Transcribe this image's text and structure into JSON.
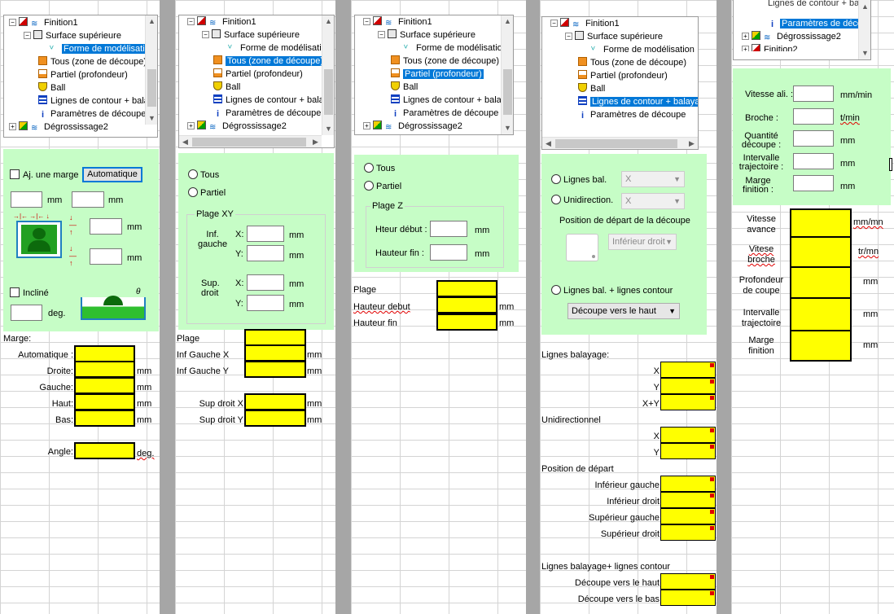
{
  "tree": {
    "finition1": "Finition1",
    "surface": "Surface supérieure",
    "forme": "Forme de modélisation",
    "tous": "Tous (zone de découpe)",
    "partiel": "Partiel (profondeur)",
    "ball": "Ball",
    "lignes": "Lignes de contour + balayage",
    "lignes_short": "Lignes de contour + balay·",
    "params": "Paramètres de découpe",
    "degro": "Dégrossissage2",
    "finition2": "Finition2",
    "lignes_top": "Lignes de contour + balay·"
  },
  "p1": {
    "chk_marge": "Aj. une marge",
    "btn_auto": "Automatique",
    "unit_mm": "mm",
    "chk_incline": "Incliné",
    "unit_deg": "deg.",
    "sheet": {
      "marge": "Marge:",
      "auto": "Automatique :",
      "droite": "Droite:",
      "gauche": "Gauche:",
      "haut": "Haut:",
      "bas": "Bas:",
      "angle": "Angle:",
      "mm": "mm",
      "deg": "deg."
    }
  },
  "p2": {
    "tous": "Tous",
    "partiel": "Partiel",
    "plage_xy": "Plage XY",
    "inf_gauche": "Inf.\ngauche",
    "sup_droit": "Sup.\ndroit",
    "x": "X:",
    "y": "Y:",
    "mm": "mm",
    "sheet": {
      "plage": "Plage",
      "infx": "Inf Gauche X",
      "infy": "Inf Gauche Y",
      "supx": "Sup droit X",
      "supy": "Sup droit Y",
      "mm": "mm"
    }
  },
  "p3": {
    "tous": "Tous",
    "partiel": "Partiel",
    "plage_z": "Plage Z",
    "hdebut": "Hteur début :",
    "hfin": "Hauteur fin :",
    "mm": "mm",
    "sheet": {
      "plage": "Plage",
      "hdebut": "Hauteur debut",
      "hfin": "Hauteur fin",
      "mm": "mm"
    }
  },
  "p4": {
    "lignes_bal": "Lignes bal.",
    "unidir": "Unidirection.",
    "x_opt": "X",
    "pos_depart": "Position de départ de la découpe",
    "inf_droit_opt": "Inférieur droit",
    "lignes_bal_contour": "Lignes bal. + lignes contour",
    "decoupe_haut": "Découpe vers le haut",
    "sheet": {
      "lignes_balayage": "Lignes balayage:",
      "x": "X",
      "y": "Y",
      "xy": "X+Y",
      "unidir": "Unidirectionnel",
      "pos": "Position de départ",
      "inf_gauche": "Inférieur gauche",
      "inf_droit": "Inférieur droit",
      "sup_gauche": "Supérieur gauche",
      "sup_droit": "Supérieur droit",
      "lbc": "Lignes balayage+ lignes contour",
      "dh": "Découpe vers le haut",
      "db": "Découpe vers le bas"
    }
  },
  "p5": {
    "vitesse_ali": "Vitesse ali. :",
    "broche": "Broche :",
    "quantite": "Quantité\ndécoupe :",
    "intervalle": "Intervalle\ntrajectoire :",
    "marge": "Marge\nfinition :",
    "mm_min": "mm/min",
    "t_min": "t/min",
    "mm": "mm",
    "sheet": {
      "vitesse": "Vitesse\navance",
      "vitese": "Vitese\nbroche",
      "profondeur": "Profondeur\nde coupe",
      "intervalle": "Intervalle\ntrajectoire",
      "marge": "Marge\nfinition",
      "mm_mn": "mm/mn",
      "tr_mn": "tr/mn",
      "mm": "mm"
    }
  }
}
